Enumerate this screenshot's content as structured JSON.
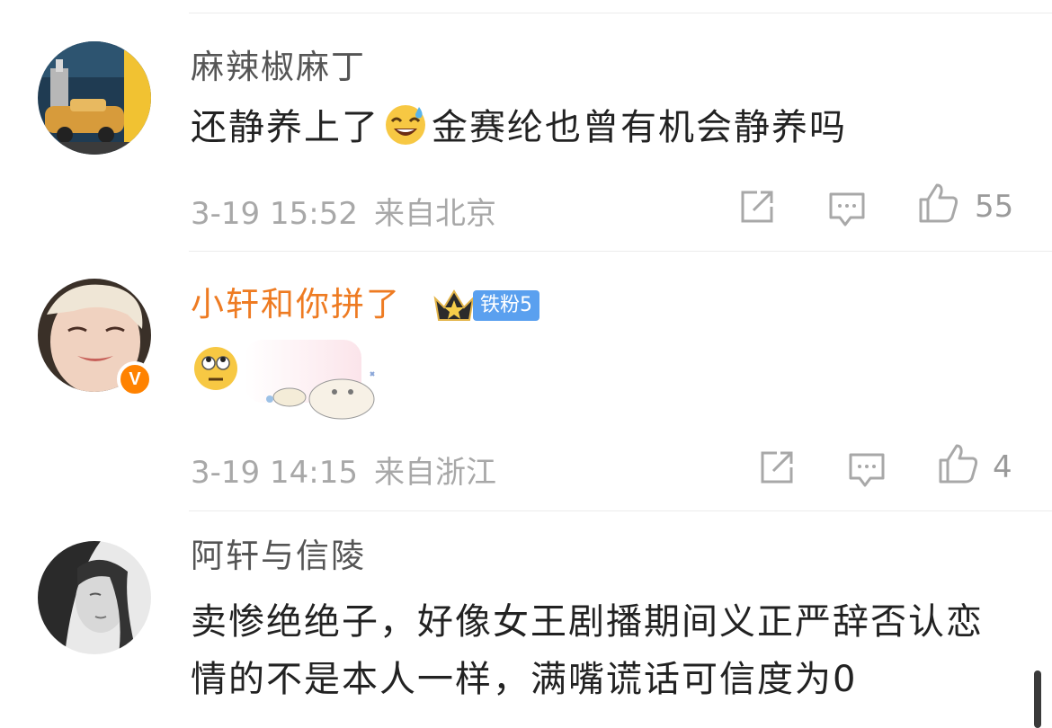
{
  "comments": [
    {
      "username": "麻辣椒麻丁",
      "content_before": "还静养上了",
      "content_after": "金赛纶也曾有机会静养吗",
      "time": "3-19 15:52",
      "location": "来自北京",
      "likes": "55",
      "emoji": "sweat-smile-emoji"
    },
    {
      "username": "小轩和你拼了",
      "fan_badge": "铁粉5",
      "time": "3-19 14:15",
      "location": "来自浙江",
      "likes": "4",
      "verified": "V",
      "emoji": "eye-roll-emoji"
    },
    {
      "username": "阿轩与信陵",
      "content": "卖惨绝绝子，好像女王剧播期间义正严辞否认恋情的不是本人一样，满嘴谎话可信度为0"
    }
  ],
  "colors": {
    "vip_name": "#ee7b22",
    "fan_badge": "#5aa0ef",
    "verified": "#ff8200",
    "meta_text": "#a8a8a8"
  }
}
